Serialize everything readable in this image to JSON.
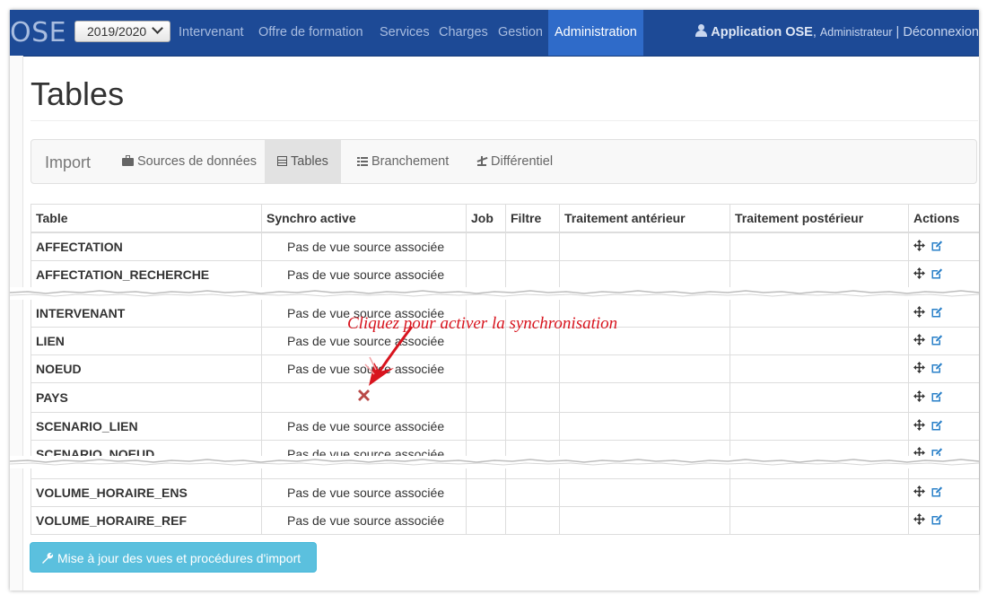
{
  "navbar": {
    "brand": "OSE",
    "year": "2019/2020",
    "items": [
      "Intervenant",
      "Offre de formation",
      "Services",
      "Charges",
      "Gestion",
      "Administration"
    ],
    "active_item": "Administration",
    "user_name": "Application OSE",
    "user_role": "Administrateur",
    "separator": "|",
    "logout": "Déconnexion"
  },
  "page": {
    "title": "Tables"
  },
  "subnav": {
    "brand": "Import",
    "items": [
      {
        "label": "Sources de données",
        "icon": "briefcase-icon"
      },
      {
        "label": "Tables",
        "icon": "table-icon"
      },
      {
        "label": "Branchement",
        "icon": "list-icon"
      },
      {
        "label": "Différentiel",
        "icon": "scale-icon"
      }
    ]
  },
  "table": {
    "headers": [
      "Table",
      "Synchro active",
      "Job",
      "Filtre",
      "Traitement antérieur",
      "Traitement postérieur",
      "Actions"
    ],
    "rows": [
      {
        "name": "AFFECTATION",
        "sync": "Pas de vue source associée"
      },
      {
        "name": "AFFECTATION_RECHERCHE",
        "sync": "Pas de vue source associée"
      },
      {
        "name": "INTERVENANT",
        "sync": "Pas de vue source associée"
      },
      {
        "name": "LIEN",
        "sync": "Pas de vue source associée"
      },
      {
        "name": "NOEUD",
        "sync": "Pas de vue source associée"
      },
      {
        "name": "PAYS",
        "sync": ""
      },
      {
        "name": "SCENARIO_LIEN",
        "sync": "Pas de vue source associée"
      },
      {
        "name": "SCENARIO_NOEUD",
        "sync": "Pas de vue source associée"
      },
      {
        "name": "VOLUME_HORAIRE_ENS",
        "sync": "Pas de vue source associée"
      },
      {
        "name": "VOLUME_HORAIRE_REF",
        "sync": "Pas de vue source associée"
      }
    ]
  },
  "annotation": "Cliquez pour activer la synchronisation",
  "update_button": "Mise à jour des vues et procédures d'import",
  "colors": {
    "navbar": "#1d4a96",
    "nav_active": "#2f6bc9",
    "info_button": "#5bc0de",
    "annotation": "#d8141e",
    "sync_disabled": "#b94a48",
    "action_icon": "#2a80c8"
  }
}
